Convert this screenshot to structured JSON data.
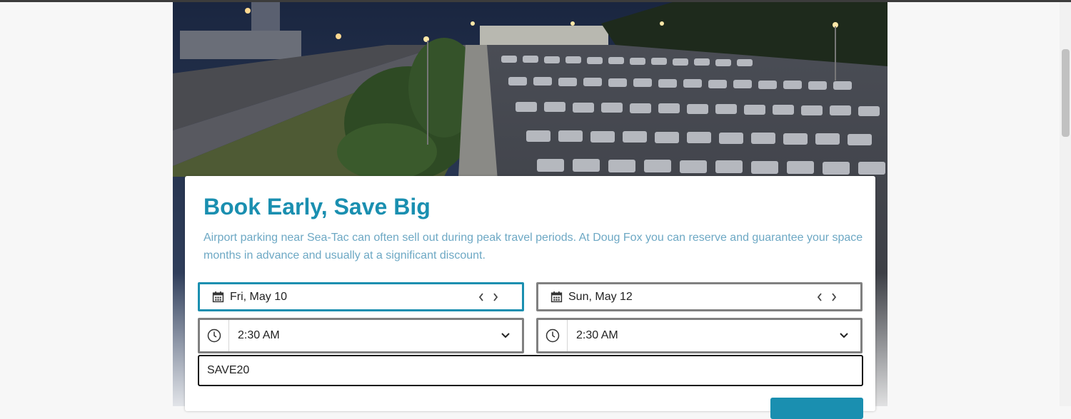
{
  "booking": {
    "title": "Book Early, Save Big",
    "description": "Airport parking near Sea-Tac can often sell out during peak travel periods. At Doug Fox you can reserve and guarantee your space months in advance and usually at a significant discount.",
    "dropoff_date": "Fri, May 10",
    "pickup_date": "Sun, May 12",
    "dropoff_time": "2:30 AM",
    "pickup_time": "2:30 AM",
    "promo_code": "SAVE20"
  },
  "colors": {
    "accent": "#1a8fb0",
    "description_text": "#6da8c4",
    "field_border": "#808080"
  },
  "icons": {
    "date": "calendar-icon",
    "time": "clock-icon",
    "dropdown": "chevron-down-icon",
    "prev": "chevron-left-icon",
    "next": "chevron-right-icon"
  }
}
